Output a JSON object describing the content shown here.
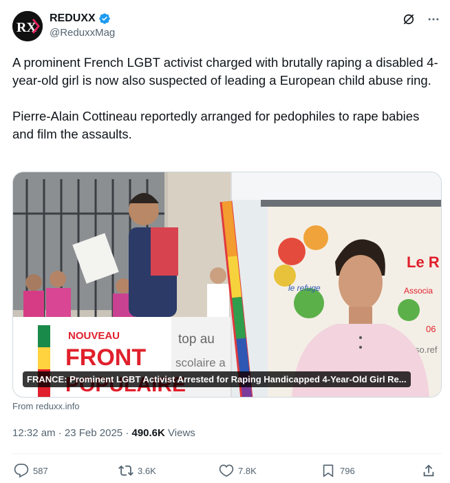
{
  "author": {
    "display_name": "REDUXX",
    "handle": "@ReduxxMag",
    "avatar_text": "RX",
    "verified": true
  },
  "header_icons": [
    "grok-icon",
    "more-icon"
  ],
  "tweet": {
    "text": "A prominent French LGBT activist charged with brutally raping a disabled 4-year-old girl is now also suspected of leading a European child abuse ring.\n\nPierre-Alain Cottineau reportedly arranged for pedophiles to rape babies and film the assaults."
  },
  "media": {
    "caption": "FRANCE: Prominent LGBT Activist Arrested for Raping Handicapped 4-Year-Old Girl Re...",
    "left_photo": {
      "banner_line1": "NOUVEAU",
      "banner_line2": "FRONT",
      "banner_line3": "POPULAIRE",
      "sign_text": "top au",
      "sign_text2": "scolaire a"
    },
    "right_photo": {
      "banner_text1": "Le R",
      "banner_text2": "Associa",
      "banner_text3": "le refuge",
      "banner_text4": "06",
      "banner_text5": "so.ref"
    }
  },
  "source": "From reduxx.info",
  "meta": {
    "time": "12:32 am",
    "separator": "·",
    "date": "23 Feb 2025",
    "views_count": "490.6K",
    "views_label": "Views"
  },
  "actions": {
    "replies": "587",
    "reposts": "3.6K",
    "likes": "7.8K",
    "bookmarks": "796"
  },
  "colors": {
    "accent": "#1d9bf0",
    "text": "#0f1419",
    "secondary": "#536471"
  }
}
